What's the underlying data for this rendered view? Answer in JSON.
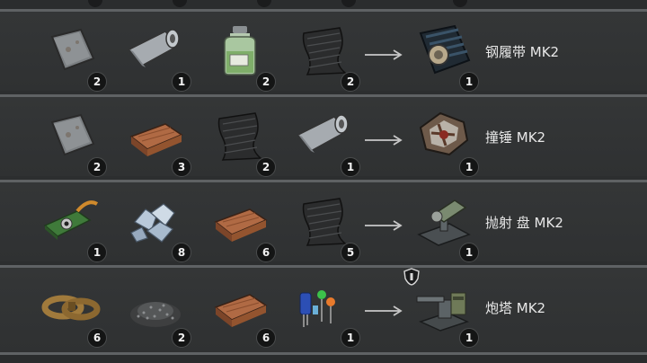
{
  "recipes": [
    {
      "result": {
        "name": "钢履带 MK2",
        "count": "1",
        "icon": "tank-tracks-icon"
      },
      "ingredients": [
        {
          "icon": "metal-plate-icon",
          "count": "2"
        },
        {
          "icon": "steel-roll-icon",
          "count": "1"
        },
        {
          "icon": "chemical-jar-icon",
          "count": "2"
        },
        {
          "icon": "carbon-fabric-icon",
          "count": "2"
        }
      ]
    },
    {
      "result": {
        "name": "撞锤 MK2",
        "count": "1",
        "icon": "ram-icon"
      },
      "ingredients": [
        {
          "icon": "metal-plate-icon",
          "count": "2"
        },
        {
          "icon": "wood-plank-icon",
          "count": "3"
        },
        {
          "icon": "carbon-fabric-icon",
          "count": "2"
        },
        {
          "icon": "steel-roll-icon",
          "count": "1"
        }
      ]
    },
    {
      "result": {
        "name": "抛射 盘 MK2",
        "count": "1",
        "icon": "disc-launcher-icon"
      },
      "ingredients": [
        {
          "icon": "circuit-board-icon",
          "count": "1"
        },
        {
          "icon": "crystal-chunks-icon",
          "count": "8"
        },
        {
          "icon": "wood-plank-icon",
          "count": "6"
        },
        {
          "icon": "carbon-fabric-icon",
          "count": "5"
        }
      ]
    },
    {
      "result": {
        "name": "炮塔 MK2",
        "count": "1",
        "icon": "turret-icon"
      },
      "ingredients": [
        {
          "icon": "leather-straps-icon",
          "count": "6"
        },
        {
          "icon": "gravel-pile-icon",
          "count": "2"
        },
        {
          "icon": "wood-plank-icon",
          "count": "6"
        },
        {
          "icon": "electronic-components-icon",
          "count": "1"
        }
      ]
    }
  ],
  "colors": {
    "background": "#2c2e2f",
    "divider": "#5f6264",
    "badge": "#141515",
    "text": "#e8e8e8"
  }
}
